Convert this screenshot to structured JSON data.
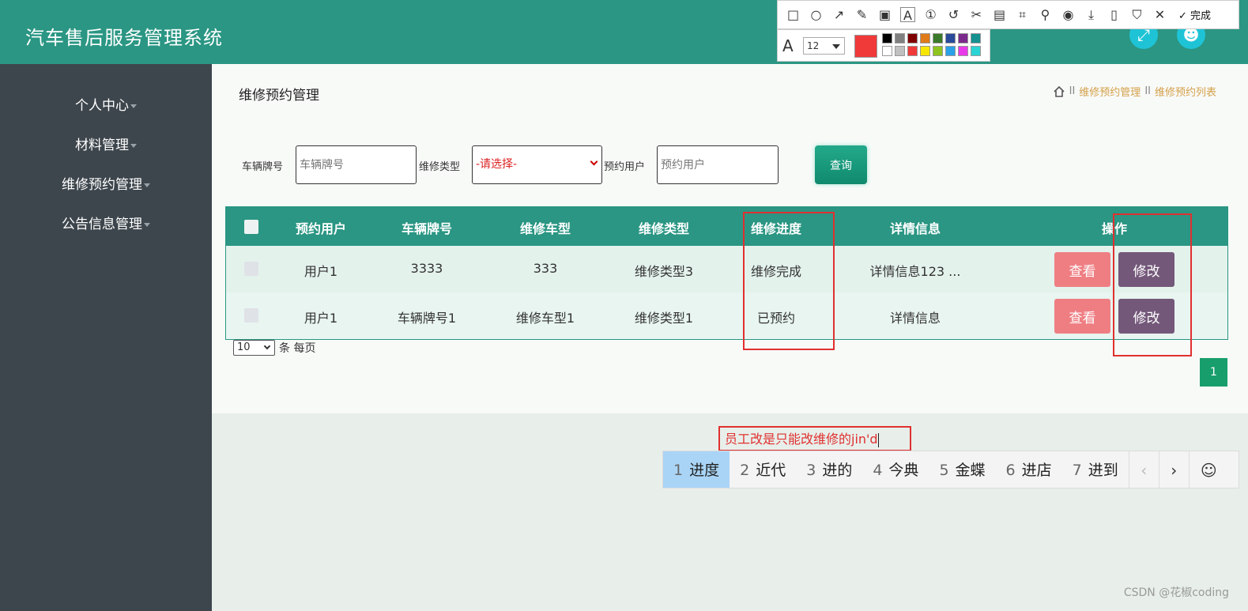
{
  "app": {
    "title": "汽车售后服务管理系统"
  },
  "header": {
    "fullscreen_icon": "expand-icon",
    "user_icon": "user-icon"
  },
  "sidebar": {
    "items": [
      {
        "label": "个人中心"
      },
      {
        "label": "材料管理"
      },
      {
        "label": "维修预约管理"
      },
      {
        "label": "公告信息管理"
      }
    ]
  },
  "page": {
    "title": "维修预约管理"
  },
  "breadcrumb": {
    "items": [
      "维修预约管理",
      "维修预约列表"
    ]
  },
  "search": {
    "plate_label": "车辆牌号",
    "plate_placeholder": "车辆牌号",
    "type_label": "维修类型",
    "type_value": "-请选择-",
    "user_label": "预约用户",
    "user_placeholder": "预约用户",
    "query_label": "查询"
  },
  "table": {
    "headers": [
      "预约用户",
      "车辆牌号",
      "维修车型",
      "维修类型",
      "维修进度",
      "详情信息",
      "操作"
    ],
    "rows": [
      {
        "user": "用户1",
        "plate": "3333",
        "model": "333",
        "type": "维修类型3",
        "progress": "维修完成",
        "detail": "详情信息123 ...",
        "view": "查看",
        "edit": "修改"
      },
      {
        "user": "用户1",
        "plate": "车辆牌号1",
        "model": "维修车型1",
        "type": "维修类型1",
        "progress": "已预约",
        "detail": "详情信息",
        "view": "查看",
        "edit": "修改"
      }
    ]
  },
  "pagination": {
    "page_size": "10",
    "per_page_label": "条 每页",
    "current_page": "1"
  },
  "annotation": {
    "text": "员工改是只能改维修的jin'd"
  },
  "ime": {
    "candidates": [
      {
        "n": "1",
        "word": "进度"
      },
      {
        "n": "2",
        "word": "近代"
      },
      {
        "n": "3",
        "word": "进的"
      },
      {
        "n": "4",
        "word": "今典"
      },
      {
        "n": "5",
        "word": "金蝶"
      },
      {
        "n": "6",
        "word": "进店"
      },
      {
        "n": "7",
        "word": "进到"
      }
    ],
    "prev": "‹",
    "next": "›",
    "emoji": "☺"
  },
  "screenshot_tool": {
    "done_label": "完成",
    "font_size": "12",
    "current_color": "#f03a3a"
  },
  "watermark": "CSDN @花椒coding"
}
